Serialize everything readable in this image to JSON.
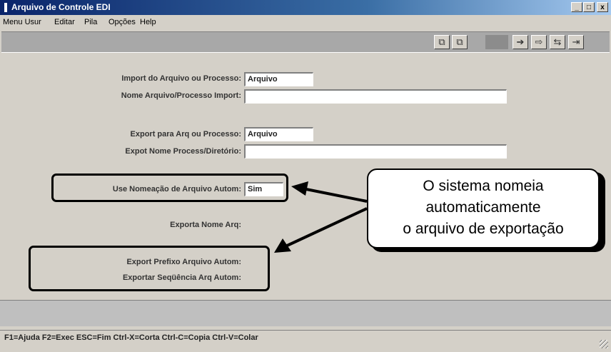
{
  "window": {
    "title": "Arquivo de Controle EDI",
    "buttons": {
      "minimize": "_",
      "maximize": "□",
      "close": "x"
    }
  },
  "menu": [
    "Menu Usur",
    "Editar",
    "Pila",
    "Opções",
    "Help"
  ],
  "toolbar": {
    "icons": [
      "copy-icon",
      "paste-icon",
      "export-icon",
      "import-icon",
      "transfer-icon",
      "exit-icon"
    ]
  },
  "form": {
    "import_source_label": "Import do Arquivo ou Processo:",
    "import_source_value": "Arquivo",
    "import_name_label": "Nome Arquivo/Processo Import:",
    "import_name_value": "",
    "export_target_label": "Export para Arq ou Processo:",
    "export_target_value": "Arquivo",
    "export_name_label": "Expot Nome Process/Diretório:",
    "export_name_value": "",
    "auto_naming_label": "Use Nomeação de Arquivo Autom:",
    "auto_naming_value": "Sim",
    "export_file_name_label": "Exporta Nome Arq:",
    "auto_prefix_label": "Export Prefixo Arquivo Autom:",
    "auto_sequence_label": "Exportar Seqüência Arq Autom:"
  },
  "callout": {
    "line1": "O sistema nomeia",
    "line2": "automaticamente",
    "line3": "o arquivo de exportação"
  },
  "status": {
    "hotkeys": "F1=Ajuda F2=Exec ESC=Fim Ctrl-X=Corta Ctrl-C=Copia Ctrl-V=Colar"
  }
}
